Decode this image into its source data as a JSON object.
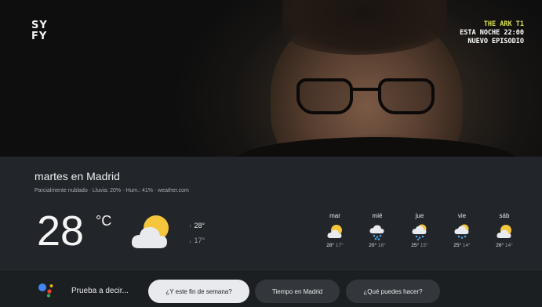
{
  "channel": {
    "logo_text": "SY FY",
    "promo": {
      "line1": "THE ARK T1",
      "line2": "ESTA NOCHE 22:00",
      "line3": "NUEVO EPISODIO"
    }
  },
  "weather": {
    "title": "martes en Madrid",
    "details": "Parcialmente nublado · Lluvia: 20% · Hum.: 41% · weather.com",
    "current_temp": "28",
    "unit": "°C",
    "icon": "partly-cloudy-icon",
    "high": "28°",
    "low": "17°",
    "forecast": [
      {
        "day": "mar",
        "icon": "partly-cloudy-icon",
        "high": "28°",
        "low": "17°"
      },
      {
        "day": "mié",
        "icon": "rain-cloud-icon",
        "high": "20°",
        "low": "16°"
      },
      {
        "day": "jue",
        "icon": "rain-sun-icon",
        "high": "25°",
        "low": "15°"
      },
      {
        "day": "vie",
        "icon": "rain-sun-icon",
        "high": "25°",
        "low": "14°"
      },
      {
        "day": "sáb",
        "icon": "partly-cloudy-icon",
        "high": "26°",
        "low": "14°"
      }
    ]
  },
  "assistant_bar": {
    "prompt": "Prueba a decir...",
    "suggestions": [
      {
        "label": "¿Y este fin de semana?",
        "active": true
      },
      {
        "label": "Tiempo en Madrid",
        "active": false
      },
      {
        "label": "¿Qué puedes hacer?",
        "active": false
      }
    ]
  },
  "colors": {
    "panel_bg": "#222529",
    "bar_bg": "#1c1f22",
    "sun": "#f5c53c",
    "cloud": "#e8eaed",
    "rain": "#4fa3e0",
    "promo_accent": "#d9e24b"
  }
}
